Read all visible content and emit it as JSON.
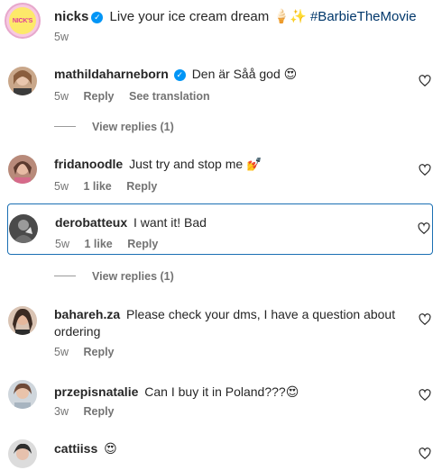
{
  "post": {
    "avatar_text": "NICK'S",
    "username": "nicks",
    "caption_text": "Live your ice cream dream",
    "caption_emoji": "🍦✨",
    "hashtag": "#BarbieTheMovie",
    "time": "5w"
  },
  "comments": [
    {
      "user": "mathildaharneborn",
      "verified": true,
      "text": "Den är Såå god 😍",
      "time": "5w",
      "likes": "",
      "reply": "Reply",
      "extra": "See translation",
      "view_replies": "View replies (1)"
    },
    {
      "user": "fridanoodle",
      "text": "Just try and stop me 💅",
      "time": "5w",
      "likes": "1 like",
      "reply": "Reply"
    },
    {
      "user": "derobatteux",
      "text": "I want it! Bad",
      "time": "5w",
      "likes": "1 like",
      "reply": "Reply",
      "view_replies": "View replies (1)"
    },
    {
      "user": "bahareh.za",
      "text": "Please check your dms, I have a question about ordering",
      "time": "5w",
      "reply": "Reply"
    },
    {
      "user": "przepisnatalie",
      "text": "Can I buy it in Poland???😍",
      "time": "3w",
      "reply": "Reply"
    },
    {
      "user": "cattiiss",
      "text": "😍"
    }
  ],
  "colors": {
    "link": "#00376b",
    "verified": "#0095f6",
    "muted": "#737373",
    "selection": "#1a6fb3"
  }
}
